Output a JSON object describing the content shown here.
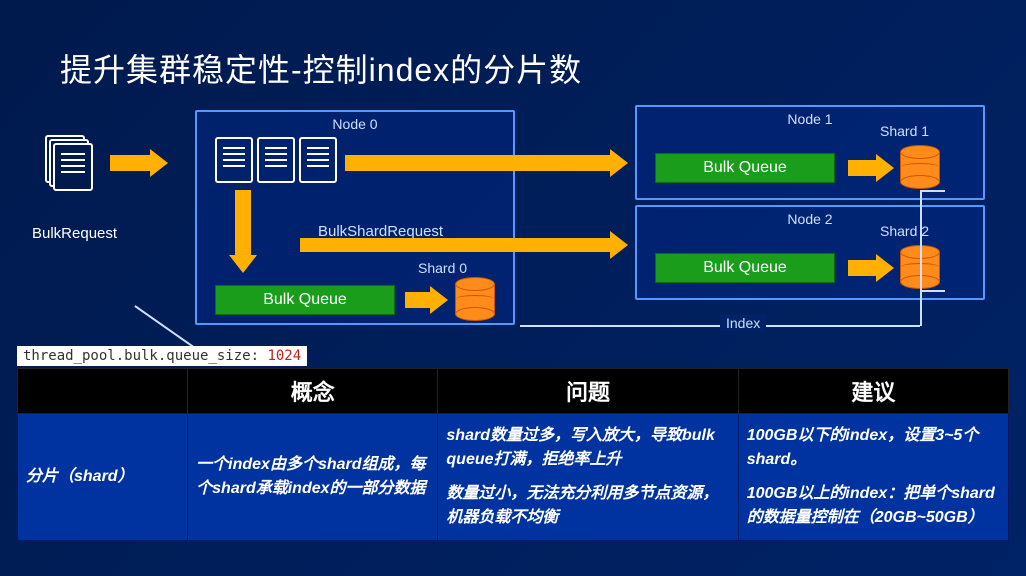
{
  "title": "提升集群稳定性-控制index的分片数",
  "diagram": {
    "bulk_request_label": "BulkRequest",
    "bulk_shard_request_label": "BulkShardRequest",
    "node0_label": "Node 0",
    "node1_label": "Node 1",
    "node2_label": "Node 2",
    "shard0_label": "Shard 0",
    "shard1_label": "Shard 1",
    "shard2_label": "Shard 2",
    "bulk_queue_label": "Bulk Queue",
    "index_label": "Index",
    "code_key": "thread_pool.bulk.queue_size: ",
    "code_value": "1024"
  },
  "table": {
    "headers": {
      "concept": "概念",
      "problem": "问题",
      "suggestion": "建议"
    },
    "row_label": "分片（shard）",
    "concept": "一个index由多个shard组成，每个shard承载index的一部分数据",
    "problem1": "shard数量过多，写入放大，导致bulk queue打满，拒绝率上升",
    "problem2": "数量过小，无法充分利用多节点资源，机器负载不均衡",
    "suggest1": "100GB以下的index，设置3~5个shard。",
    "suggest2": "100GB以上的index：把单个shard的数据量控制在（20GB~50GB）"
  }
}
